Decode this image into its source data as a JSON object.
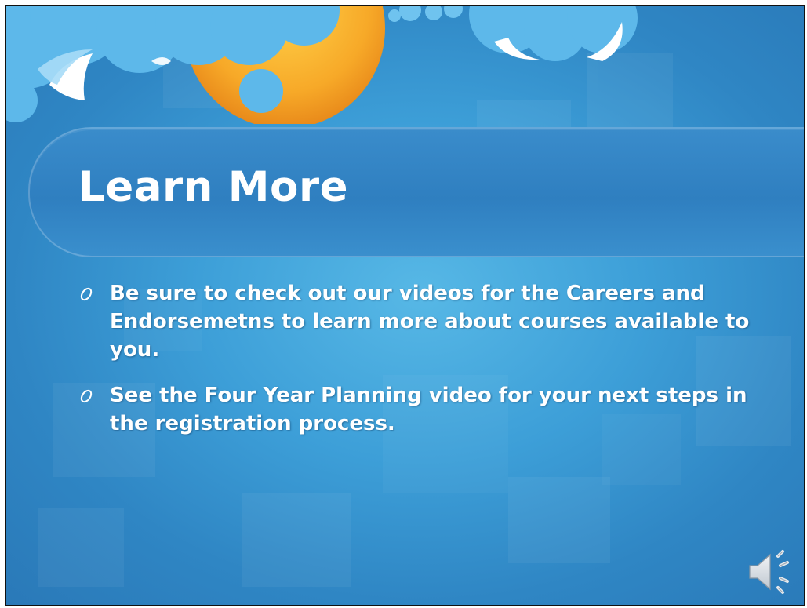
{
  "slide": {
    "title": "Learn More",
    "bullets": [
      "Be sure to check out our videos for the Careers and Endorsemetns to learn more about courses available to you.",
      "See the Four Year Planning video for your next steps in the registration process."
    ]
  },
  "colors": {
    "background_center": "#57b8e6",
    "background_edge": "#2a79b8",
    "title_band": "#2f7fc0",
    "cloud": "#5db8ea",
    "sun": "#f5a623",
    "text": "#ffffff"
  },
  "icons": {
    "bullet": "ring-bullet-icon",
    "audio": "speaker-icon"
  }
}
